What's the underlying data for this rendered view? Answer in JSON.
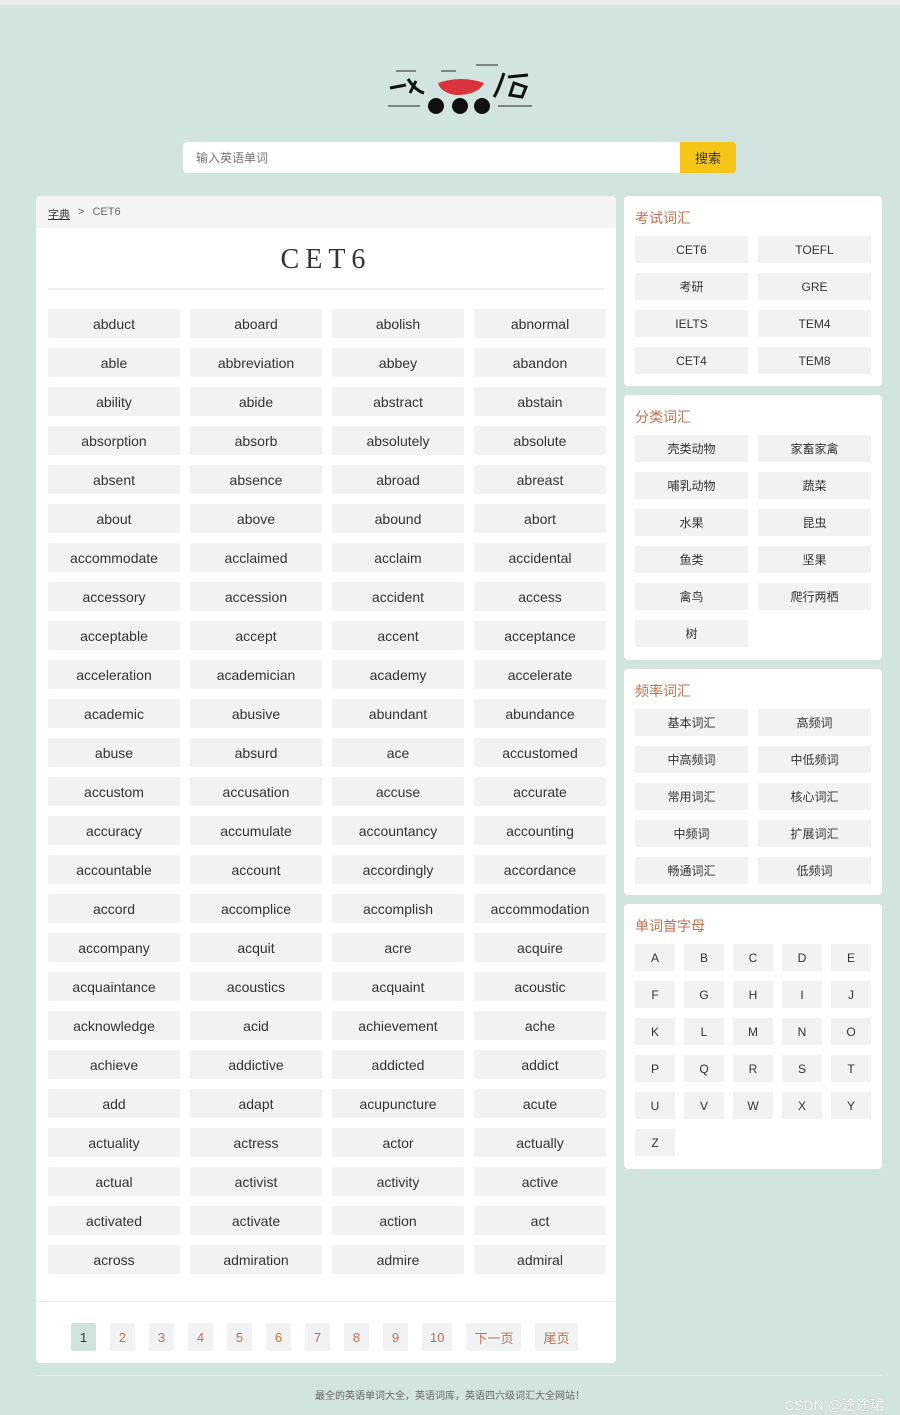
{
  "logo": {
    "text": "六六六 字词句"
  },
  "search": {
    "placeholder": "输入英语单词",
    "button": "搜索"
  },
  "breadcrumb": {
    "home": "字典",
    "separator": ">",
    "current": "CET6"
  },
  "page_title": "CET6",
  "words": [
    "abduct",
    "aboard",
    "abolish",
    "abnormal",
    "able",
    "abbreviation",
    "abbey",
    "abandon",
    "ability",
    "abide",
    "abstract",
    "abstain",
    "absorption",
    "absorb",
    "absolutely",
    "absolute",
    "absent",
    "absence",
    "abroad",
    "abreast",
    "about",
    "above",
    "abound",
    "abort",
    "accommodate",
    "acclaimed",
    "acclaim",
    "accidental",
    "accessory",
    "accession",
    "accident",
    "access",
    "acceptable",
    "accept",
    "accent",
    "acceptance",
    "acceleration",
    "academician",
    "academy",
    "accelerate",
    "academic",
    "abusive",
    "abundant",
    "abundance",
    "abuse",
    "absurd",
    "ace",
    "accustomed",
    "accustom",
    "accusation",
    "accuse",
    "accurate",
    "accuracy",
    "accumulate",
    "accountancy",
    "accounting",
    "accountable",
    "account",
    "accordingly",
    "accordance",
    "accord",
    "accomplice",
    "accomplish",
    "accommodation",
    "accompany",
    "acquit",
    "acre",
    "acquire",
    "acquaintance",
    "acoustics",
    "acquaint",
    "acoustic",
    "acknowledge",
    "acid",
    "achievement",
    "ache",
    "achieve",
    "addictive",
    "addicted",
    "addict",
    "add",
    "adapt",
    "acupuncture",
    "acute",
    "actuality",
    "actress",
    "actor",
    "actually",
    "actual",
    "activist",
    "activity",
    "active",
    "activated",
    "activate",
    "action",
    "act",
    "across",
    "admiration",
    "admire",
    "admiral"
  ],
  "pagination": {
    "pages": [
      "1",
      "2",
      "3",
      "4",
      "5",
      "6",
      "7",
      "8",
      "9",
      "10"
    ],
    "current": "1",
    "next": "下一页",
    "last": "尾页"
  },
  "sidebar": {
    "exam": {
      "title": "考试词汇",
      "items": [
        "CET6",
        "TOEFL",
        "考研",
        "GRE",
        "IELTS",
        "TEM4",
        "CET4",
        "TEM8"
      ]
    },
    "category": {
      "title": "分类词汇",
      "items": [
        "壳类动物",
        "家畜家禽",
        "哺乳动物",
        "蔬菜",
        "水果",
        "昆虫",
        "鱼类",
        "坚果",
        "禽鸟",
        "爬行两栖",
        "树"
      ]
    },
    "frequency": {
      "title": "频率词汇",
      "items": [
        "基本词汇",
        "高频词",
        "中高频词",
        "中低频词",
        "常用词汇",
        "核心词汇",
        "中频词",
        "扩展词汇",
        "畅通词汇",
        "低频词"
      ]
    },
    "letters": {
      "title": "单词首字母",
      "items": [
        "A",
        "B",
        "C",
        "D",
        "E",
        "F",
        "G",
        "H",
        "I",
        "J",
        "K",
        "L",
        "M",
        "N",
        "O",
        "P",
        "Q",
        "R",
        "S",
        "T",
        "U",
        "V",
        "W",
        "X",
        "Y",
        "Z"
      ]
    }
  },
  "footer": {
    "text": "最全的英语单词大全，英语词库，英语四六级词汇大全网站！"
  },
  "watermark": "CSDN @途途珺",
  "colors": {
    "background": "#d2e4df",
    "accent": "#c0714f",
    "search_button": "#f5c518",
    "active_page": "#cfe3dc"
  }
}
